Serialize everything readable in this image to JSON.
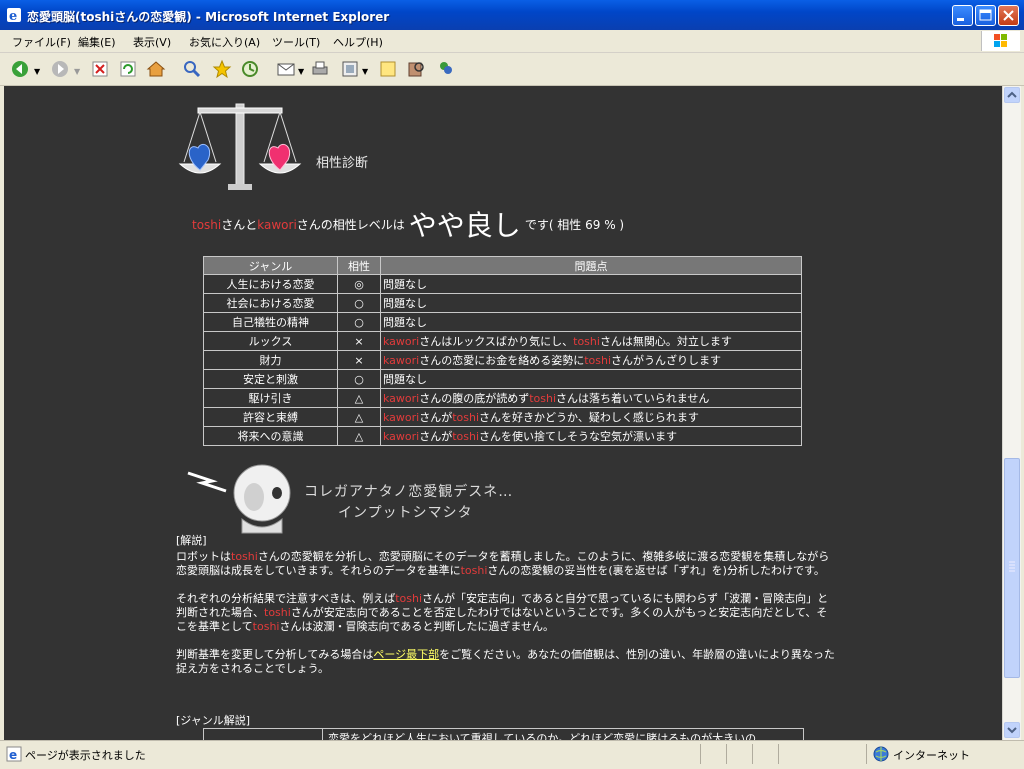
{
  "window": {
    "title": "恋愛頭脳(toshiさんの恋愛観) - Microsoft Internet Explorer",
    "buttons": {
      "minimize": "_",
      "maximize": "□",
      "close": "✕"
    }
  },
  "menubar": {
    "items": [
      "ファイル(F)",
      "編集(E)",
      "表示(V)",
      "お気に入り(A)",
      "ツール(T)",
      "ヘルプ(H)"
    ]
  },
  "toolbar": {
    "icons": [
      "back-icon",
      "forward-icon",
      "stop-icon",
      "refresh-icon",
      "home-icon",
      "search-icon",
      "favorites-icon",
      "history-icon",
      "mail-icon",
      "print-icon",
      "edit-icon",
      "discuss-icon",
      "research-icon",
      "messenger-icon"
    ]
  },
  "page": {
    "aishou_label": "相性診断",
    "result": {
      "name1": "toshi",
      "mid1": "さんと",
      "name2": "kawori",
      "mid2": "さんの相性レベルは",
      "level": "やや良し",
      "suffix": "です( 相性 69 % )"
    },
    "table": {
      "headers": [
        "ジャンル",
        "相性",
        "問題点"
      ],
      "rows": [
        {
          "genre": "人生における恋愛",
          "mark": "◎",
          "problem": [
            {
              "t": "問題なし",
              "r": false
            }
          ]
        },
        {
          "genre": "社会における恋愛",
          "mark": "○",
          "problem": [
            {
              "t": "問題なし",
              "r": false
            }
          ]
        },
        {
          "genre": "自己犠牲の精神",
          "mark": "○",
          "problem": [
            {
              "t": "問題なし",
              "r": false
            }
          ]
        },
        {
          "genre": "ルックス",
          "mark": "×",
          "problem": [
            {
              "t": "kawori",
              "r": true
            },
            {
              "t": "さんはルックスばかり気にし、",
              "r": false
            },
            {
              "t": "toshi",
              "r": true
            },
            {
              "t": "さんは無関心。対立します",
              "r": false
            }
          ]
        },
        {
          "genre": "財力",
          "mark": "×",
          "problem": [
            {
              "t": "kawori",
              "r": true
            },
            {
              "t": "さんの恋愛にお金を絡める姿勢に",
              "r": false
            },
            {
              "t": "toshi",
              "r": true
            },
            {
              "t": "さんがうんざりします",
              "r": false
            }
          ]
        },
        {
          "genre": "安定と刺激",
          "mark": "○",
          "problem": [
            {
              "t": "問題なし",
              "r": false
            }
          ]
        },
        {
          "genre": "駆け引き",
          "mark": "△",
          "problem": [
            {
              "t": "kawori",
              "r": true
            },
            {
              "t": "さんの腹の底が読めず",
              "r": false
            },
            {
              "t": "toshi",
              "r": true
            },
            {
              "t": "さんは落ち着いていられません",
              "r": false
            }
          ]
        },
        {
          "genre": "許容と束縛",
          "mark": "△",
          "problem": [
            {
              "t": "kawori",
              "r": true
            },
            {
              "t": "さんが",
              "r": false
            },
            {
              "t": "toshi",
              "r": true
            },
            {
              "t": "さんを好きかどうか、疑わしく感じられます",
              "r": false
            }
          ]
        },
        {
          "genre": "将来への意識",
          "mark": "△",
          "problem": [
            {
              "t": "kawori",
              "r": true
            },
            {
              "t": "さんが",
              "r": false
            },
            {
              "t": "toshi",
              "r": true
            },
            {
              "t": "さんを使い捨てしそうな空気が漂います",
              "r": false
            }
          ]
        }
      ]
    },
    "robot_message": [
      "コレガアナタノ恋愛観デスネ…",
      "インプットシマシタ"
    ],
    "explanation": {
      "heading": "[解説]",
      "paragraphs": [
        [
          {
            "t": "ロボットは",
            "r": false
          },
          {
            "t": "toshi",
            "r": true
          },
          {
            "t": "さんの恋愛観を分析し、恋愛頭脳にそのデータを蓄積しました。このように、複雑多岐に渡る恋愛観を集積しながら恋愛頭脳は成長をしていきます。それらのデータを基準に",
            "r": false
          },
          {
            "t": "toshi",
            "r": true
          },
          {
            "t": "さんの恋愛観の妥当性を(裏を返せば「ずれ」を)分析したわけです。",
            "r": false
          }
        ],
        [
          {
            "t": "それぞれの分析結果で注意すべきは、例えば",
            "r": false
          },
          {
            "t": "toshi",
            "r": true
          },
          {
            "t": "さんが「安定志向」であると自分で思っているにも関わらず「波瀾・冒険志向」と判断された場合、",
            "r": false
          },
          {
            "t": "toshi",
            "r": true
          },
          {
            "t": "さんが安定志向であることを否定したわけではないということです。多くの人がもっと安定志向だとして、そこを基準として",
            "r": false
          },
          {
            "t": "toshi",
            "r": true
          },
          {
            "t": "さんは波瀾・冒険志向であると判断したに過ぎません。",
            "r": false
          }
        ]
      ],
      "p3_before": "判断基準を変更して分析してみる場合は",
      "p3_link": "ページ最下部",
      "p3_after": "をご覧ください。あなたの価値観は、性別の違い、年齢層の違いにより異なった捉え方をされることでしょう。"
    },
    "genre_heading": "[ジャンル解説]",
    "bottom_cell_text": "恋愛をどれほど人生において重視しているのか。どれほど恋愛に賭けるものが大きいの"
  },
  "statusbar": {
    "status": "ページが表示されました",
    "zone": "インターネット"
  },
  "colors": {
    "accent_red": "#e23b3b",
    "page_bg": "#333333",
    "link": "#ffff66"
  }
}
